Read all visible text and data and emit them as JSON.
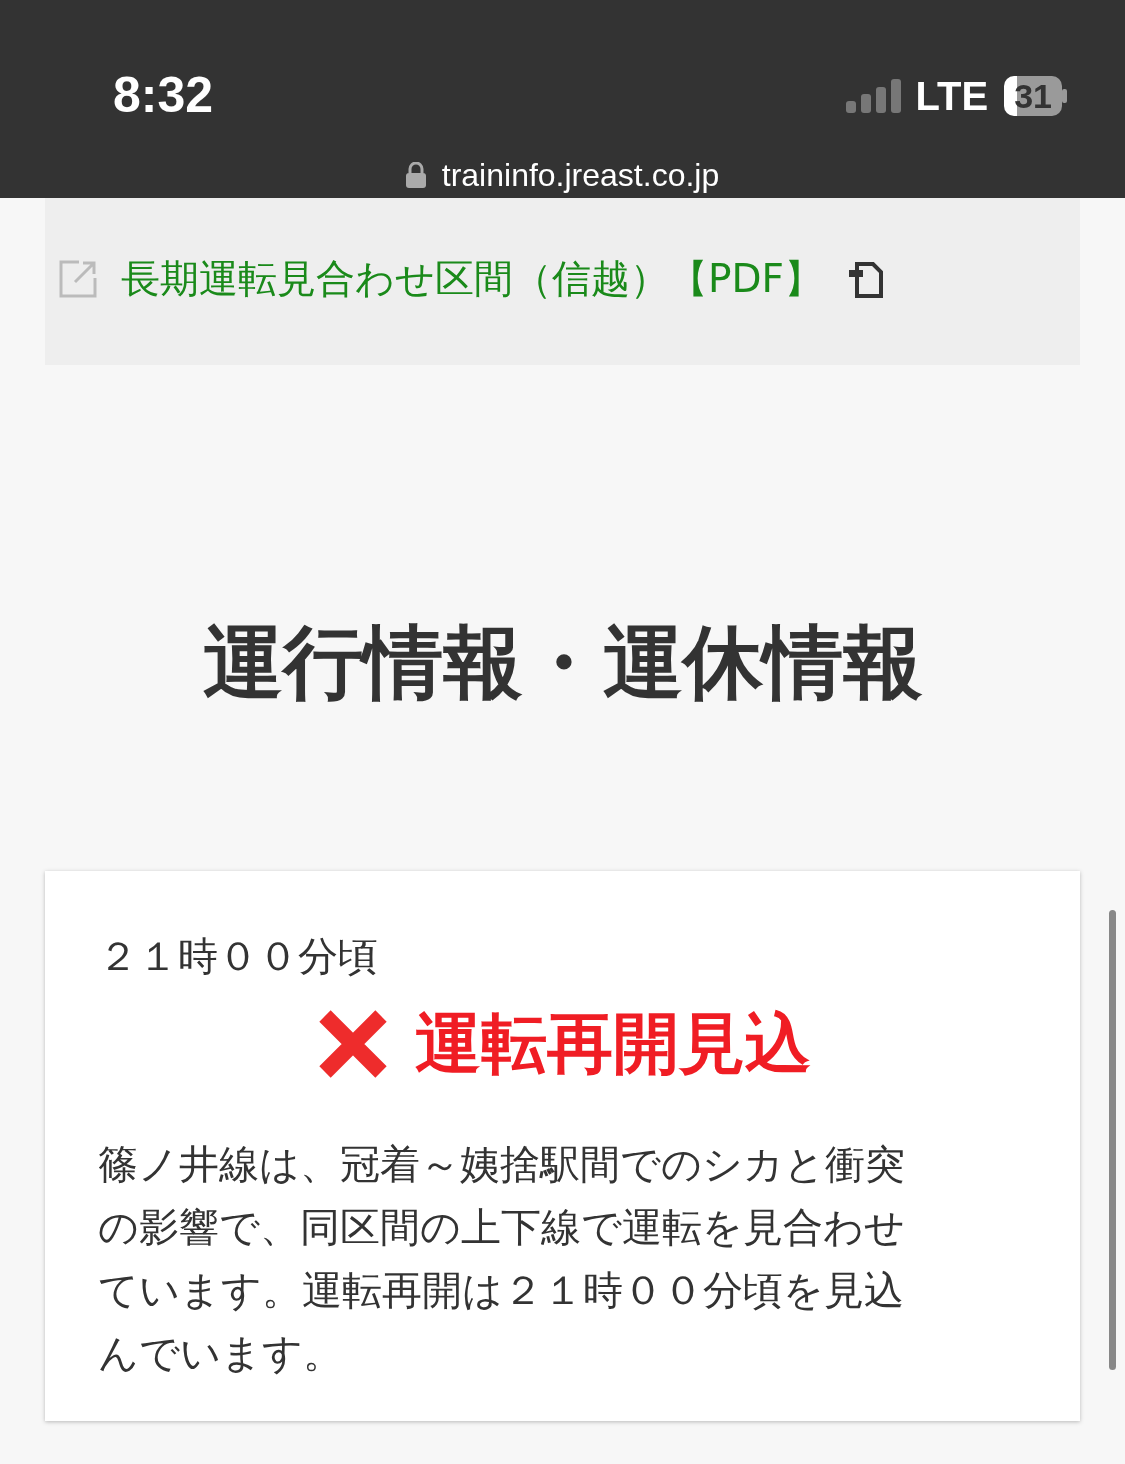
{
  "status_bar": {
    "time": "8:32",
    "network": "LTE",
    "battery": "31",
    "url": "traininfo.jreast.co.jp"
  },
  "links": [
    {
      "label": "長期運転見合わせ区間（信越）【PDF】"
    }
  ],
  "heading": "運行情報・運休情報",
  "notice": {
    "time": "２１時００分頃",
    "status": "運転再開見込",
    "message": "篠ノ井線は、冠着～姨捨駅間でのシカと衝突の影響で、同区間の上下線で運転を見合わせています。運転再開は２１時００分頃を見込んでいます。"
  }
}
